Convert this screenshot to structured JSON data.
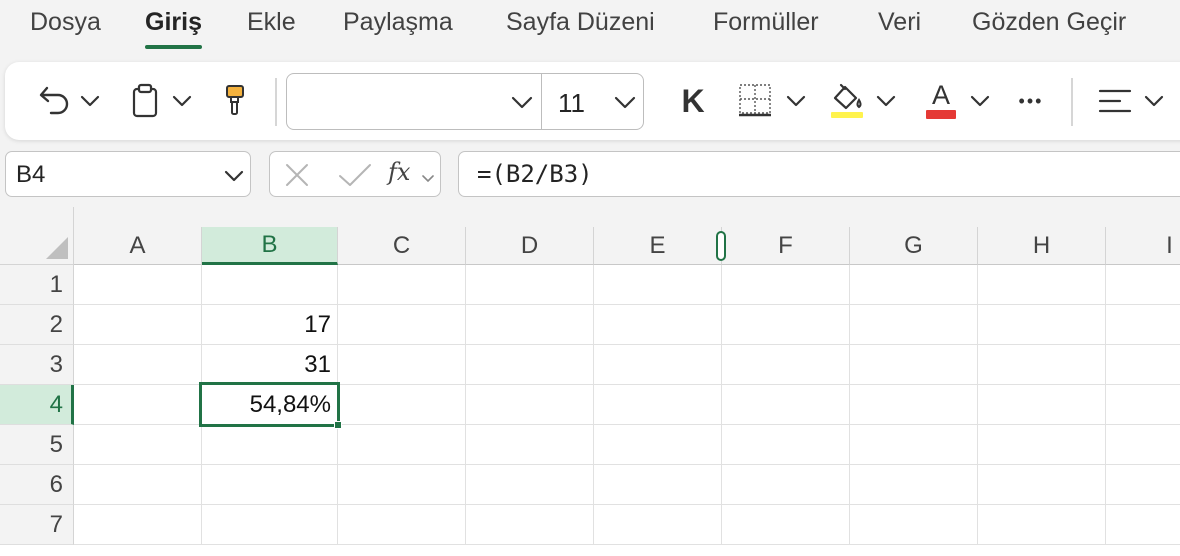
{
  "tabs": [
    {
      "label": "Dosya",
      "active": false
    },
    {
      "label": "Giriş",
      "active": true
    },
    {
      "label": "Ekle",
      "active": false
    },
    {
      "label": "Paylaşma",
      "active": false
    },
    {
      "label": "Sayfa Düzeni",
      "active": false
    },
    {
      "label": "Formüller",
      "active": false
    },
    {
      "label": "Veri",
      "active": false
    },
    {
      "label": "Gözden Geçir",
      "active": false
    }
  ],
  "ribbon": {
    "font_name": "",
    "font_size": "11",
    "bold_label": "K",
    "font_color_label": "A",
    "more_label": "•••",
    "icons": [
      "undo-icon",
      "clipboard-paste-icon",
      "format-painter-icon",
      "bold-icon",
      "borders-icon",
      "fill-color-icon",
      "font-color-icon",
      "more-icon",
      "align-icon"
    ],
    "colors": {
      "fill_highlight": "#fff34d",
      "font_color": "#e53935",
      "accent": "#217346"
    }
  },
  "formula_bar": {
    "name_box": "B4",
    "fx_label": "fx",
    "formula": "=(B2/B3)"
  },
  "sheet": {
    "columns": [
      "A",
      "B",
      "C",
      "D",
      "E",
      "F",
      "G",
      "H",
      "I"
    ],
    "rows": [
      "1",
      "2",
      "3",
      "4",
      "5",
      "6",
      "7"
    ],
    "selected_column": "B",
    "selected_row": "4",
    "cells": {
      "B2": "17",
      "B3": "31",
      "B4": "54,84%"
    }
  }
}
